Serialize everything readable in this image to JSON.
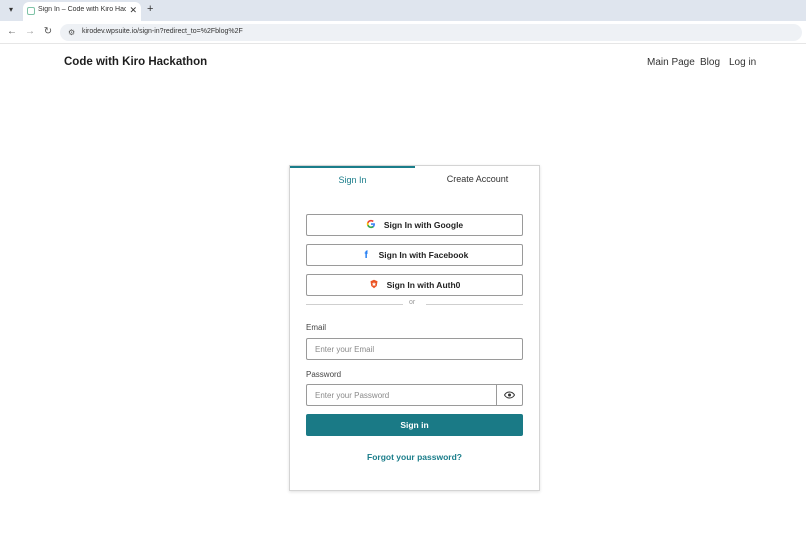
{
  "browser": {
    "tab_title": "Sign In – Code with Kiro Hackathon",
    "tab_close_icon": "close-icon",
    "new_tab_icon": "plus-icon",
    "url": "kirodev.wpsuite.io/sign-in?redirect_to=%2Fblog%2F"
  },
  "site": {
    "title": "Code with Kiro Hackathon",
    "nav": [
      "Main Page",
      "Blog",
      "Log in"
    ]
  },
  "auth": {
    "tabs": {
      "signin": "Sign In",
      "create": "Create Account"
    },
    "social": {
      "google": "Sign In with Google",
      "facebook": "Sign In with Facebook",
      "auth0": "Sign In with Auth0"
    },
    "divider": "or",
    "email": {
      "label": "Email",
      "placeholder": "Enter your Email"
    },
    "password": {
      "label": "Password",
      "placeholder": "Enter your Password"
    },
    "submit": "Sign in",
    "forgot": "Forgot your password?"
  },
  "colors": {
    "accent": "#1a7a86",
    "google_blue": "#4285f4",
    "facebook_blue": "#1877f2",
    "auth0_red": "#eb5424"
  }
}
